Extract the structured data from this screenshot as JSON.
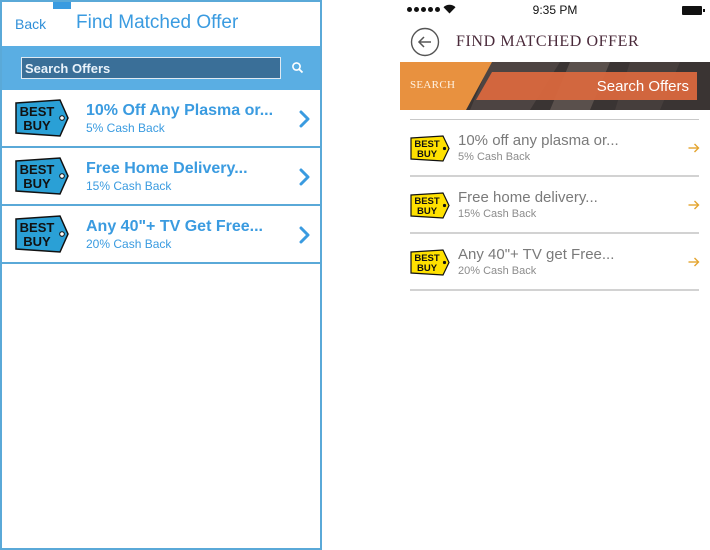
{
  "left": {
    "back_label": "Back",
    "title": "Find Matched Offer",
    "search_placeholder": "Search Offers",
    "offers": [
      {
        "title": "10% Off Any Plasma or...",
        "subtitle": "5% Cash Back"
      },
      {
        "title": "Free Home Delivery...",
        "subtitle": "15% Cash Back"
      },
      {
        "title": "Any 40\"+ TV Get Free...",
        "subtitle": "20% Cash Back"
      }
    ],
    "accent_color": "#3a9be0"
  },
  "right": {
    "status": {
      "time": "9:35 PM"
    },
    "title": "FIND MATCHED OFFER",
    "search_label": "SEARCH",
    "search_placeholder": "Search Offers",
    "offers": [
      {
        "title": "10% off any plasma or...",
        "subtitle": "5% Cash Back"
      },
      {
        "title": "Free home delivery...",
        "subtitle": "15% Cash Back"
      },
      {
        "title": "Any 40\"+ TV get Free...",
        "subtitle": "20% Cash Back"
      }
    ],
    "accent_color": "#e8a033",
    "arrow_color": "#e3a42e"
  },
  "logo": {
    "line1": "BEST",
    "line2": "BUY"
  },
  "icons": [
    "search-icon",
    "chevron-right-icon",
    "back-arrow-icon",
    "arrow-right-icon",
    "wifi-icon",
    "battery-icon"
  ]
}
